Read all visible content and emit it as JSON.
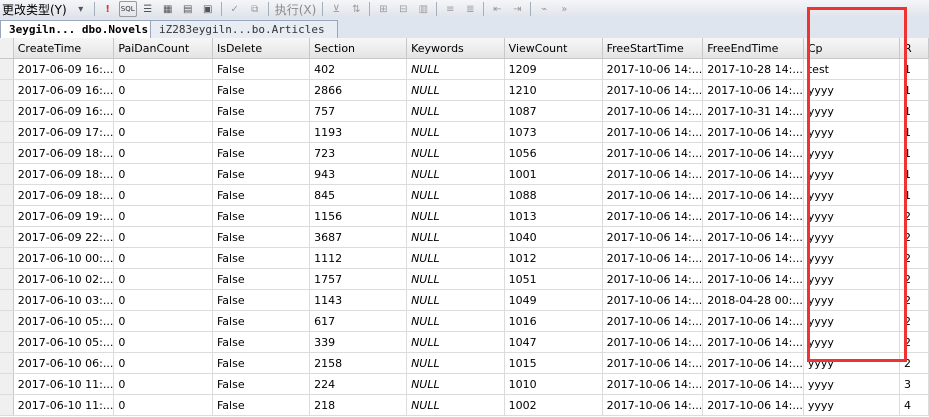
{
  "toolbar": {
    "change_type_label": "更改类型(Y)",
    "execute_label": "执行(X)"
  },
  "tabs": [
    {
      "label": "3eygiln... dbo.Novels"
    },
    {
      "label": "iZ283eygiln...bo.Articles"
    }
  ],
  "columns": [
    "CreateTime",
    "PaiDanCount",
    "IsDelete",
    "Section",
    "Keywords",
    "ViewCount",
    "FreeStartTime",
    "FreeEndTime",
    "Cp",
    "R"
  ],
  "rows": [
    [
      "2017-06-09 16:...",
      "0",
      "False",
      "402",
      "NULL",
      "1209",
      "2017-10-06 14:...",
      "2017-10-28 14:...",
      "test",
      "1"
    ],
    [
      "2017-06-09 16:...",
      "0",
      "False",
      "2866",
      "NULL",
      "1210",
      "2017-10-06 14:...",
      "2017-10-06 14:...",
      "yyyy",
      "1"
    ],
    [
      "2017-06-09 16:...",
      "0",
      "False",
      "757",
      "NULL",
      "1087",
      "2017-10-06 14:...",
      "2017-10-31 14:...",
      "yyyy",
      "1"
    ],
    [
      "2017-06-09 17:...",
      "0",
      "False",
      "1193",
      "NULL",
      "1073",
      "2017-10-06 14:...",
      "2017-10-06 14:...",
      "yyyy",
      "1"
    ],
    [
      "2017-06-09 18:...",
      "0",
      "False",
      "723",
      "NULL",
      "1056",
      "2017-10-06 14:...",
      "2017-10-06 14:...",
      "yyyy",
      "1"
    ],
    [
      "2017-06-09 18:...",
      "0",
      "False",
      "943",
      "NULL",
      "1001",
      "2017-10-06 14:...",
      "2017-10-06 14:...",
      "yyyy",
      "1"
    ],
    [
      "2017-06-09 18:...",
      "0",
      "False",
      "845",
      "NULL",
      "1088",
      "2017-10-06 14:...",
      "2017-10-06 14:...",
      "yyyy",
      "1"
    ],
    [
      "2017-06-09 19:...",
      "0",
      "False",
      "1156",
      "NULL",
      "1013",
      "2017-10-06 14:...",
      "2017-10-06 14:...",
      "yyyy",
      "2"
    ],
    [
      "2017-06-09 22:...",
      "0",
      "False",
      "3687",
      "NULL",
      "1040",
      "2017-10-06 14:...",
      "2017-10-06 14:...",
      "yyyy",
      "2"
    ],
    [
      "2017-06-10 00:...",
      "0",
      "False",
      "1112",
      "NULL",
      "1012",
      "2017-10-06 14:...",
      "2017-10-06 14:...",
      "yyyy",
      "2"
    ],
    [
      "2017-06-10 02:...",
      "0",
      "False",
      "1757",
      "NULL",
      "1051",
      "2017-10-06 14:...",
      "2017-10-06 14:...",
      "yyyy",
      "2"
    ],
    [
      "2017-06-10 03:...",
      "0",
      "False",
      "1143",
      "NULL",
      "1049",
      "2017-10-06 14:...",
      "2018-04-28 00:...",
      "yyyy",
      "2"
    ],
    [
      "2017-06-10 05:...",
      "0",
      "False",
      "617",
      "NULL",
      "1016",
      "2017-10-06 14:...",
      "2017-10-06 14:...",
      "yyyy",
      "2"
    ],
    [
      "2017-06-10 05:...",
      "0",
      "False",
      "339",
      "NULL",
      "1047",
      "2017-10-06 14:...",
      "2017-10-06 14:...",
      "yyyy",
      "2"
    ],
    [
      "2017-06-10 06:...",
      "0",
      "False",
      "2158",
      "NULL",
      "1015",
      "2017-10-06 14:...",
      "2017-10-06 14:...",
      "yyyy",
      "2"
    ],
    [
      "2017-06-10 11:...",
      "0",
      "False",
      "224",
      "NULL",
      "1010",
      "2017-10-06 14:...",
      "2017-10-06 14:...",
      "yyyy",
      "3"
    ],
    [
      "2017-06-10 11:...",
      "0",
      "False",
      "218",
      "NULL",
      "1002",
      "2017-10-06 14:...",
      "2017-10-06 14:...",
      "yyyy",
      "4"
    ]
  ]
}
